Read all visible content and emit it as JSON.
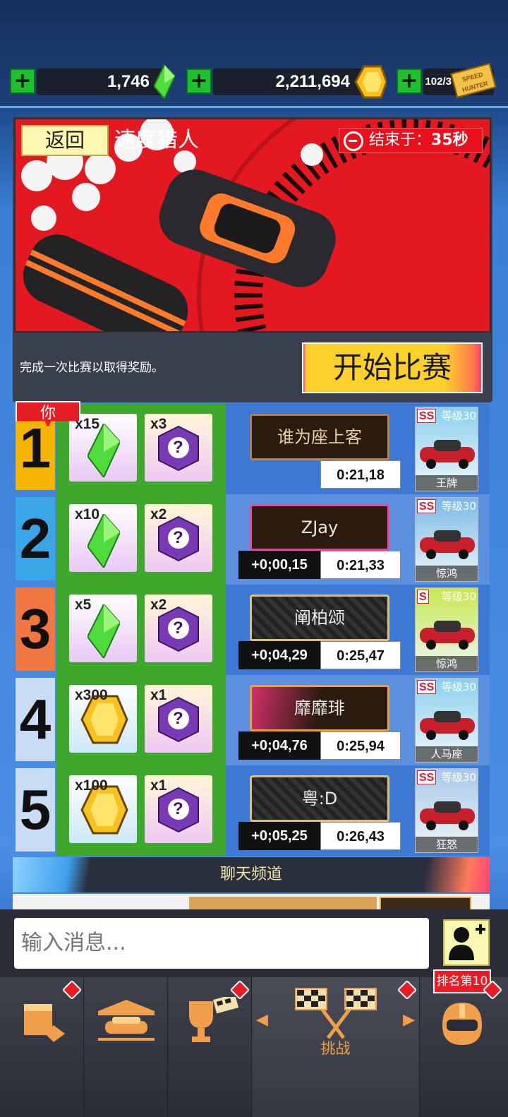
{
  "currency": {
    "gems": "1,746",
    "coins": "2,211,694",
    "tickets": "102/3",
    "ticket_text": "SPEED HUNTER"
  },
  "event": {
    "back_label": "返回",
    "title": "速度猎人",
    "timer_label": "结束于：",
    "timer_value": "35秒",
    "description": "完成一次比赛以取得奖励。",
    "start_label": "开始比赛"
  },
  "you_label": "你",
  "leaderboard": [
    {
      "rank": "1",
      "reward1_type": "gem",
      "reward1_qty": "x15",
      "reward2_qty": "x3",
      "player": "谁为座上客",
      "gap": "",
      "time": "0:21,18",
      "car_class": "SS",
      "car_level": "等级30",
      "car_name": "王牌",
      "rank_color": "#f5b400"
    },
    {
      "rank": "2",
      "reward1_type": "gem",
      "reward1_qty": "x10",
      "reward2_qty": "x2",
      "player": "ZJay",
      "gap": "+0;00,15",
      "time": "0:21,33",
      "car_class": "SS",
      "car_level": "等级30",
      "car_name": "惊鸿",
      "rank_color": "#3aa6e8"
    },
    {
      "rank": "3",
      "reward1_type": "gem",
      "reward1_qty": "x5",
      "reward2_qty": "x2",
      "player": "阐柏颂",
      "gap": "+0;04,29",
      "time": "0:25,47",
      "car_class": "S",
      "car_level": "等级30",
      "car_name": "惊鸿",
      "rank_color": "#f07840"
    },
    {
      "rank": "4",
      "reward1_type": "coin",
      "reward1_qty": "x300",
      "reward2_qty": "x1",
      "player": "靡靡琲",
      "gap": "+0;04,76",
      "time": "0:25,94",
      "car_class": "SS",
      "car_level": "等级30",
      "car_name": "人马座",
      "rank_color": "#c8dcf4"
    },
    {
      "rank": "5",
      "reward1_type": "coin",
      "reward1_qty": "x100",
      "reward2_qty": "x1",
      "player": "粤:D",
      "gap": "+0;05,25",
      "time": "0:26,43",
      "car_class": "SS",
      "car_level": "等级30",
      "car_name": "狂怒",
      "rank_color": "#c8dcf4"
    }
  ],
  "chat": {
    "channel_label": "聊天频道",
    "input_placeholder": "输入消息..."
  },
  "nav": {
    "challenge_label": "挑战",
    "rank_badge": "排名第10"
  },
  "mystery_mark": "?"
}
